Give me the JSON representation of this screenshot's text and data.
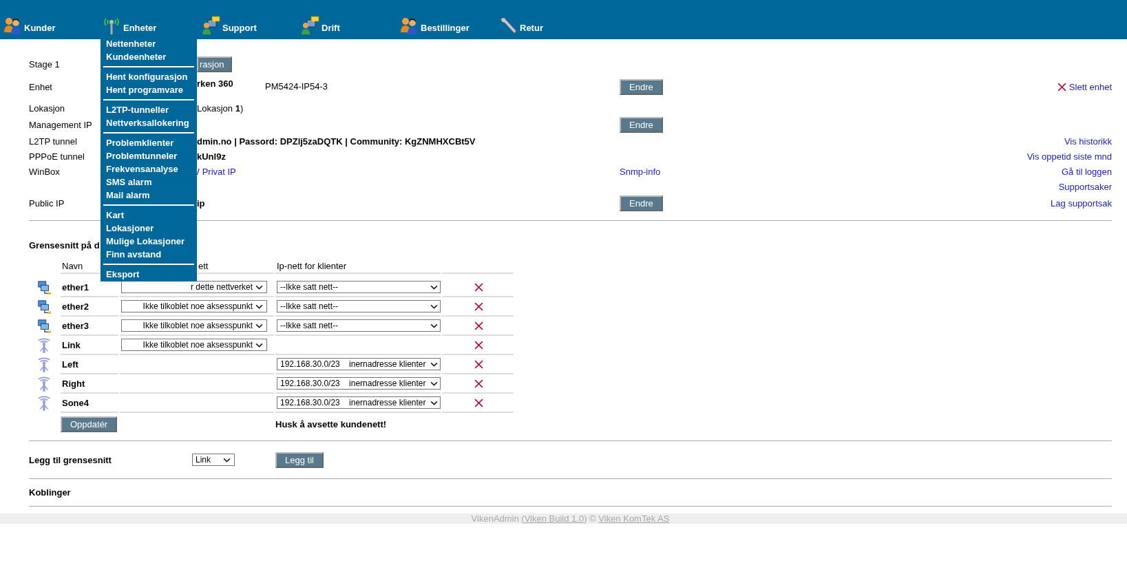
{
  "nav": [
    {
      "kind": "people",
      "label": "Kunder"
    },
    {
      "kind": "antenna",
      "label": "Enheter"
    },
    {
      "kind": "support",
      "label": "Support"
    },
    {
      "kind": "support",
      "label": "Drift"
    },
    {
      "kind": "people",
      "label": "Bestillinger"
    },
    {
      "kind": "tools",
      "label": "Retur"
    }
  ],
  "menu": [
    [
      "Nettenheter",
      "Kundeenheter"
    ],
    [
      "Hent konfigurasjon",
      "Hent programvare"
    ],
    [
      "L2TP-tunneller",
      "Nettverksallokering"
    ],
    [
      "Problemklienter",
      "Problemtunneler",
      "Frekvensanalyse",
      "SMS alarm",
      "Mail alarm"
    ],
    [
      "Kart",
      "Lokasjoner",
      "Mulige Lokasjoner",
      "Finn avstand"
    ],
    [
      "Eksport"
    ]
  ],
  "details": [
    {
      "label": "Stage 1",
      "value_button": "rasjon"
    },
    {
      "label": "Enhet",
      "value": "**rken 360**",
      "model": "PM5424-IP54-3",
      "button": "Endre",
      "right_link": "Slett enhet",
      "right_delete": true
    },
    {
      "label": "Lokasjon",
      "value": "Lokasjon **1**)"
    },
    {
      "label": "Management IP",
      "button": "Endre"
    },
    {
      "label": "L2TP tunnel",
      "value": "**dmin.no | Passord: DPZlj5zaDQTK | Community: KgZNMHXCBt5V**",
      "right_link": "Vis historikk"
    },
    {
      "label": "PPPoE tunnel",
      "value": "**kUnl9z**",
      "right_link": "Vis oppetid siste mnd"
    },
    {
      "label": "WinBox",
      "value": "/",
      "value_link": "Privat IP",
      "mid_link": "Snmp-info",
      "right_link": "Gå til loggen"
    },
    {
      "right_link": "Supportsaker"
    },
    {
      "label": "Public IP",
      "value": "**ip**",
      "button": "Endre",
      "right_link": "Lag supportsak"
    }
  ],
  "interfaces": {
    "title": "Grensesnitt på d",
    "columns": [
      "Navn",
      "ett",
      "Ip-nett for klienter"
    ],
    "rows": [
      {
        "kind": "ethernet",
        "name": "ether1",
        "network": "r dette nettverket",
        "client_net": "--Ikke satt nett--"
      },
      {
        "kind": "ethernet",
        "name": "ether2",
        "network": "Ikke tilkoblet noe aksesspunkt",
        "client_net": "--Ikke satt nett--"
      },
      {
        "kind": "ethernet",
        "name": "ether3",
        "network": "Ikke tilkoblet noe aksesspunkt",
        "client_net": "--Ikke satt nett--"
      },
      {
        "kind": "wireless",
        "name": "Link",
        "network": "Ikke tilkoblet noe aksesspunkt"
      },
      {
        "kind": "wireless",
        "name": "Left",
        "client_net": "192.168.30.0/23    inernadresse klienter"
      },
      {
        "kind": "wireless",
        "name": "Right",
        "client_net": "192.168.30.0/23    inernadresse klienter"
      },
      {
        "kind": "wireless",
        "name": "Sone4",
        "client_net": "192.168.30.0/23    inernadresse klienter"
      }
    ],
    "update_button": "Oppdatér",
    "note": "Husk å avsette kundenett!"
  },
  "add": {
    "label": "Legg til grensesnitt",
    "select": "Link",
    "button": "Legg til"
  },
  "connections": {
    "title": "Koblinger"
  },
  "footer": [
    {
      "kind": "text",
      "text": "VikenAdmin ("
    },
    {
      "kind": "link",
      "text": "Viken Build 1.0"
    },
    {
      "kind": "text",
      "text": ") © "
    },
    {
      "kind": "link",
      "text": "Viken KomTek AS"
    }
  ]
}
